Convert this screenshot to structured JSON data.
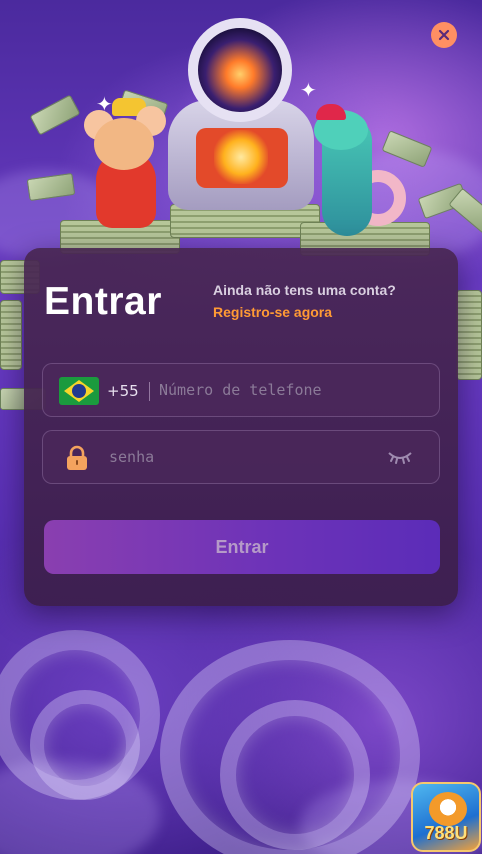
{
  "login": {
    "title": "Entrar",
    "no_account_text": "Ainda não tens uma conta?",
    "register_link": "Registro-se agora",
    "phone": {
      "country_code": "+55",
      "country_flag": "brazil-flag-icon",
      "placeholder": "Número de telefone",
      "value": ""
    },
    "password": {
      "placeholder": "senha",
      "value": ""
    },
    "submit_label": "Entrar"
  },
  "badge": {
    "text": "788U"
  },
  "colors": {
    "accent": "#ff9a35",
    "button_start": "#8a3fb0",
    "button_end": "#5b2cb8",
    "close_button": "#ff8f63"
  },
  "icons": {
    "close": "close-icon",
    "lock": "lock-icon",
    "eye": "eye-closed-icon"
  }
}
